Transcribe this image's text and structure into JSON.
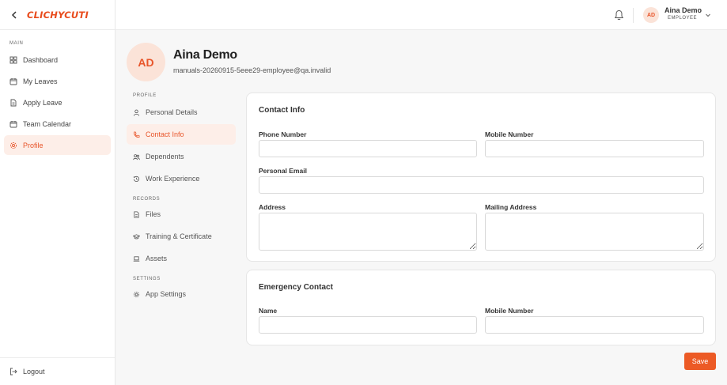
{
  "brand": {
    "logo_text": "CLICHYCUTI"
  },
  "sidebar": {
    "section_label": "MAIN",
    "items": [
      {
        "label": "Dashboard",
        "icon": "grid-icon"
      },
      {
        "label": "My Leaves",
        "icon": "calendar-icon"
      },
      {
        "label": "Apply Leave",
        "icon": "document-icon"
      },
      {
        "label": "Team Calendar",
        "icon": "calendar-icon"
      },
      {
        "label": "Profile",
        "icon": "gear-icon",
        "active": true
      }
    ],
    "logout_label": "Logout"
  },
  "topbar": {
    "avatar_initials": "AD",
    "user_name": "Aina Demo",
    "user_role": "EMPLOYEE"
  },
  "profile": {
    "avatar_initials": "AD",
    "name": "Aina Demo",
    "email": "manuals-20260915-5eee29-employee@qa.invalid"
  },
  "subnav": {
    "profile_label": "PROFILE",
    "profile_items": [
      {
        "label": "Personal Details",
        "icon": "user-icon"
      },
      {
        "label": "Contact Info",
        "icon": "phone-icon",
        "active": true
      },
      {
        "label": "Dependents",
        "icon": "users-icon"
      },
      {
        "label": "Work Experience",
        "icon": "history-icon"
      }
    ],
    "records_label": "RECORDS",
    "records_items": [
      {
        "label": "Files",
        "icon": "file-icon"
      },
      {
        "label": "Training & Certificate",
        "icon": "graduation-cap-icon"
      },
      {
        "label": "Assets",
        "icon": "laptop-icon"
      }
    ],
    "settings_label": "SETTINGS",
    "settings_items": [
      {
        "label": "App Settings",
        "icon": "gear-icon"
      }
    ]
  },
  "contact_info": {
    "title": "Contact Info",
    "phone_label": "Phone Number",
    "phone_value": "",
    "mobile_label": "Mobile Number",
    "mobile_value": "",
    "email_label": "Personal Email",
    "email_value": "",
    "address_label": "Address",
    "address_value": "",
    "mailing_label": "Mailing Address",
    "mailing_value": ""
  },
  "emergency": {
    "title": "Emergency Contact",
    "name_label": "Name",
    "name_value": "",
    "mobile_label": "Mobile Number",
    "mobile_value": ""
  },
  "actions": {
    "save_label": "Save"
  },
  "colors": {
    "accent": "#e8552a",
    "accent_bg": "#fdeee8",
    "button": "#ec5a25"
  }
}
